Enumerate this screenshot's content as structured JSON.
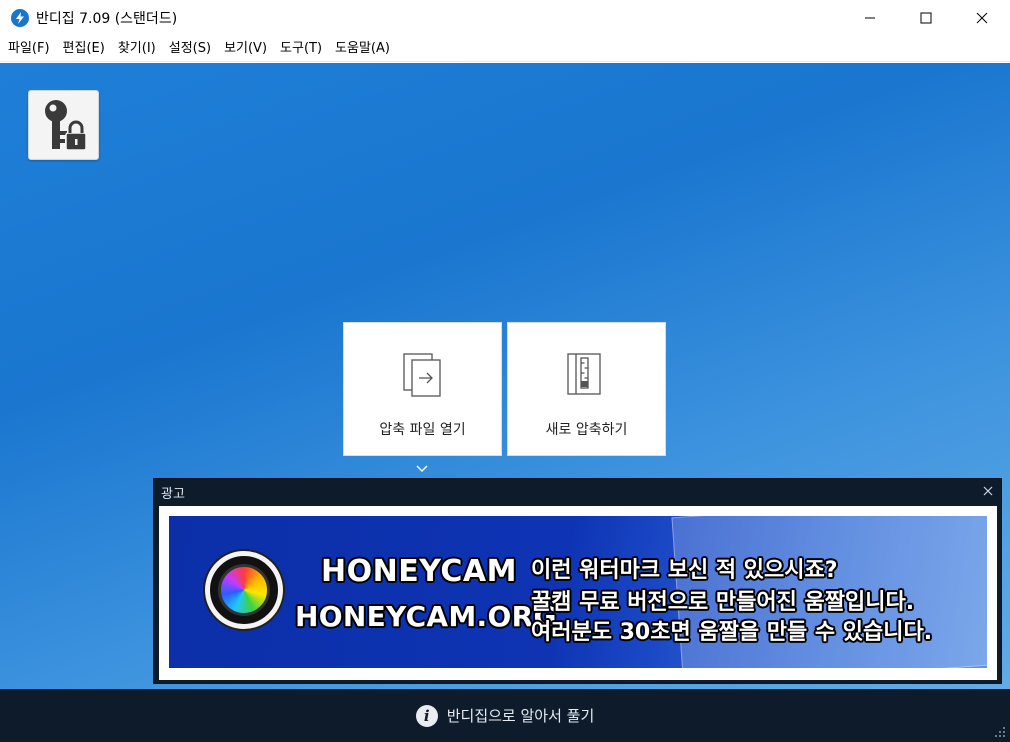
{
  "window": {
    "title": "반디집 7.09 (스탠더드)",
    "app_icon": "bandizip-logo-icon",
    "controls": [
      "minimize-icon",
      "maximize-icon",
      "close-icon"
    ]
  },
  "menu": {
    "items": [
      {
        "label": "파일(F)"
      },
      {
        "label": "편집(E)"
      },
      {
        "label": "찾기(I)"
      },
      {
        "label": "설정(S)"
      },
      {
        "label": "보기(V)"
      },
      {
        "label": "도구(T)"
      },
      {
        "label": "도움말(A)"
      }
    ]
  },
  "main": {
    "password_icon": "key-lock-icon",
    "actions": [
      {
        "label": "압축 파일 열기",
        "icon": "open-archive-icon"
      },
      {
        "label": "새로 압축하기",
        "icon": "new-archive-icon"
      }
    ],
    "expand_icon": "chevron-down-icon"
  },
  "ad": {
    "header": "광고",
    "brand": "HONEYCAM",
    "url": "HONEYCAM.ORG",
    "lines": [
      "이런 워터마크 보신 적 있으시죠?",
      "꿀캠 무료 버전으로 만들어진 움짤입니다.",
      "여러분도 30초면 움짤을 만들 수 있습니다."
    ]
  },
  "status": {
    "text": "반디집으로 알아서 풀기",
    "icon": "info-icon"
  },
  "colors": {
    "workspace_blue": "#1f7fd8",
    "dark_bar": "#0e1b2a",
    "ad_blue": "#0e34b4"
  }
}
